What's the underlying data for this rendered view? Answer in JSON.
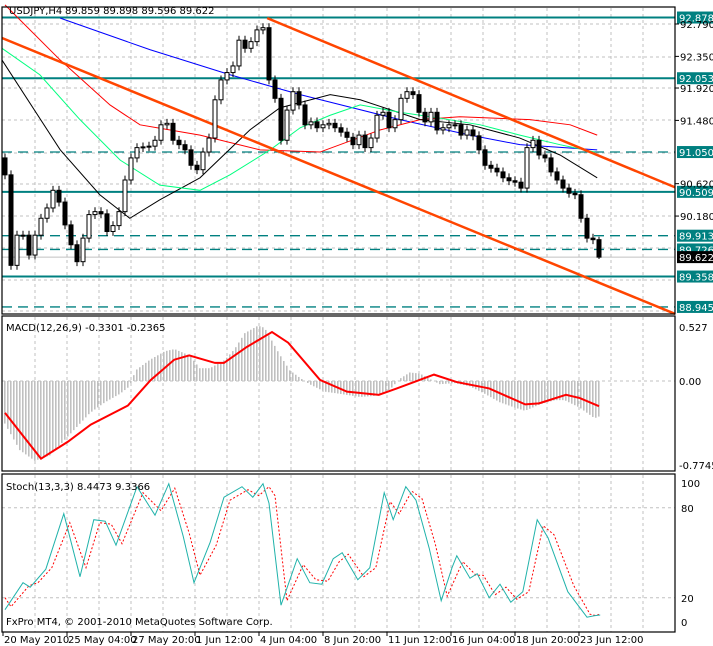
{
  "header": {
    "symbol_label": "USDJPY,H4",
    "ohlc_label": "89.859 89.898 89.596 89.622"
  },
  "macd_panel": {
    "label": "MACD(12,26,9) -0.3301 -0.2365"
  },
  "stoch_panel": {
    "label": "Stoch(13,3,3) 8.4473 9.3366"
  },
  "copyright": "FxPro MT4, © 2001-2010 MetaQuotes Software Corp.",
  "colors": {
    "level_line": "#008080",
    "trend_line": "#ff4500",
    "ma_blue": "#0000ff",
    "ma_red": "#ff0000",
    "ma_black": "#000000",
    "ma_green": "#00ff7f",
    "macd_hist": "#c0c0c0",
    "macd_signal": "#ff0000",
    "stoch_main": "#20b2aa",
    "stoch_signal": "#ff0000",
    "grid": "#c0c0c0"
  },
  "chart_data": [
    {
      "type": "candlestick",
      "title": "USDJPY,H4",
      "x_unit": "bar index (H4 bars)",
      "x_tick_labels": [
        "20 May 2010",
        "25 May 04:00",
        "27 May 20:00",
        "1 Jun 12:00",
        "4 Jun 04:00",
        "8 Jun 20:00",
        "11 Jun 12:00",
        "16 Jun 04:00",
        "18 Jun 20:00",
        "23 Jun 12:00"
      ],
      "ylim": [
        88.86,
        93.05
      ],
      "y_tick_labels": [
        "92.790",
        "92.350",
        "91.920",
        "91.480",
        "90.620",
        "90.180"
      ],
      "last": {
        "open": 89.859,
        "high": 89.898,
        "low": 89.596,
        "close": 89.622
      },
      "closes": [
        90.74,
        89.51,
        89.92,
        89.92,
        89.65,
        89.92,
        90.15,
        90.29,
        90.53,
        90.37,
        90.06,
        89.79,
        89.56,
        89.88,
        90.2,
        90.24,
        90.21,
        89.97,
        90.05,
        90.24,
        90.67,
        90.97,
        91.11,
        91.12,
        91.13,
        91.21,
        91.42,
        91.44,
        91.21,
        91.15,
        91.08,
        90.87,
        90.81,
        91.05,
        91.24,
        91.76,
        92.03,
        92.13,
        92.22,
        92.57,
        92.46,
        92.55,
        92.71,
        92.74,
        92.03,
        91.78,
        91.21,
        91.62,
        91.87,
        91.69,
        91.42,
        91.46,
        91.38,
        91.42,
        91.44,
        91.38,
        91.32,
        91.25,
        91.15,
        91.28,
        91.11,
        91.24,
        91.55,
        91.59,
        91.38,
        91.49,
        91.78,
        91.87,
        91.83,
        91.59,
        91.46,
        91.59,
        91.35,
        91.38,
        91.42,
        91.42,
        91.28,
        91.35,
        91.27,
        91.08,
        90.87,
        90.83,
        90.78,
        90.7,
        90.66,
        90.64,
        90.56,
        91.11,
        91.21,
        91.01,
        90.97,
        90.78,
        90.67,
        90.56,
        90.49,
        90.47,
        90.15,
        89.88,
        89.859,
        89.622
      ],
      "levels": [
        {
          "price": 92.878,
          "label": "92.878",
          "style": "solid"
        },
        {
          "price": 92.053,
          "label": "92.053",
          "style": "solid"
        },
        {
          "price": 91.05,
          "label": "91.050",
          "style": "dashed"
        },
        {
          "price": 90.509,
          "label": "90.509",
          "style": "solid"
        },
        {
          "price": 89.913,
          "label": "89.913",
          "style": "dashed"
        },
        {
          "price": 89.726,
          "label": "89.726",
          "style": "dashed"
        },
        {
          "price": 89.358,
          "label": "89.358",
          "style": "solid"
        },
        {
          "price": 88.945,
          "label": "88.945",
          "style": "dashed"
        }
      ],
      "bid": {
        "price": 89.622,
        "label": "89.622"
      },
      "trend_lines": [
        {
          "name": "upper-channel",
          "from": [
            43.7,
            92.87
          ],
          "to": [
            111.7,
            90.57
          ]
        },
        {
          "name": "lower-channel",
          "from": [
            -0.5,
            92.6
          ],
          "to": [
            111.7,
            88.85
          ]
        }
      ],
      "moving_averages": [
        {
          "name": "blue",
          "points": [
            [
              9.2,
              92.87
            ],
            [
              24.2,
              92.44
            ],
            [
              37.5,
              92.1
            ],
            [
              49.2,
              91.83
            ],
            [
              65.8,
              91.49
            ],
            [
              77.5,
              91.28
            ],
            [
              85.8,
              91.15
            ],
            [
              98.7,
              91.08
            ]
          ]
        },
        {
          "name": "red",
          "points": [
            [
              0,
              93.05
            ],
            [
              9.2,
              92.3
            ],
            [
              17.5,
              91.69
            ],
            [
              22.5,
              91.42
            ],
            [
              32.5,
              91.28
            ],
            [
              42.5,
              91.08
            ],
            [
              52.5,
              91.05
            ],
            [
              62.5,
              91.35
            ],
            [
              69.2,
              91.49
            ],
            [
              75.8,
              91.53
            ],
            [
              87.5,
              91.49
            ],
            [
              94.2,
              91.42
            ],
            [
              98.7,
              91.28
            ]
          ]
        },
        {
          "name": "black",
          "points": [
            [
              -0.5,
              92.3
            ],
            [
              9.2,
              91.08
            ],
            [
              15.8,
              90.47
            ],
            [
              20.8,
              90.15
            ],
            [
              25.8,
              90.4
            ],
            [
              32.5,
              90.7
            ],
            [
              40.8,
              91.35
            ],
            [
              45.8,
              91.65
            ],
            [
              54.2,
              91.83
            ],
            [
              59.2,
              91.76
            ],
            [
              69.2,
              91.49
            ],
            [
              77.5,
              91.42
            ],
            [
              85.8,
              91.24
            ],
            [
              92.5,
              91.01
            ],
            [
              98.7,
              90.7
            ]
          ]
        },
        {
          "name": "green",
          "points": [
            [
              -0.5,
              92.46
            ],
            [
              5.8,
              92.1
            ],
            [
              12.5,
              91.49
            ],
            [
              19.2,
              90.94
            ],
            [
              25.8,
              90.6
            ],
            [
              32.5,
              90.53
            ],
            [
              37.5,
              90.74
            ],
            [
              44.2,
              91.08
            ],
            [
              49.2,
              91.38
            ],
            [
              54.2,
              91.55
            ],
            [
              59.2,
              91.69
            ],
            [
              65.8,
              91.59
            ],
            [
              72.5,
              91.51
            ],
            [
              79.2,
              91.42
            ],
            [
              85.8,
              91.28
            ],
            [
              92.5,
              91.15
            ],
            [
              98.3,
              91.05
            ]
          ]
        }
      ]
    },
    {
      "type": "bar+line",
      "title": "MACD(12,26,9)",
      "ylim": [
        -0.7745,
        0.527
      ],
      "y_tick_labels": [
        "0.527",
        "0.00",
        "-0.7745"
      ],
      "main_value": -0.3301,
      "signal_value": -0.2365,
      "histogram": [
        [
          0,
          -0.4
        ],
        [
          2.5,
          -0.65
        ],
        [
          5,
          -0.75
        ],
        [
          7.5,
          -0.7
        ],
        [
          9.2,
          -0.6
        ],
        [
          11.7,
          -0.45
        ],
        [
          14.2,
          -0.3
        ],
        [
          16.7,
          -0.2
        ],
        [
          19.2,
          -0.12
        ],
        [
          20.8,
          -0.05
        ],
        [
          21.8,
          0.1
        ],
        [
          24.2,
          0.2
        ],
        [
          26.7,
          0.28
        ],
        [
          28.3,
          0.3
        ],
        [
          30.8,
          0.24
        ],
        [
          32.5,
          0.12
        ],
        [
          34.2,
          0.12
        ],
        [
          36.7,
          0.2
        ],
        [
          38.3,
          0.3
        ],
        [
          40,
          0.45
        ],
        [
          42.2,
          0.52
        ],
        [
          43.3,
          0.5
        ],
        [
          44.5,
          0.38
        ],
        [
          45.8,
          0.25
        ],
        [
          47.5,
          0.1
        ],
        [
          49.2,
          0.03
        ],
        [
          50.8,
          -0.03
        ],
        [
          53.3,
          -0.1
        ],
        [
          55.8,
          -0.12
        ],
        [
          59.2,
          -0.15
        ],
        [
          61.7,
          -0.14
        ],
        [
          64.2,
          -0.08
        ],
        [
          65.8,
          0.02
        ],
        [
          67.5,
          0.08
        ],
        [
          69.2,
          0.07
        ],
        [
          70.8,
          0.02
        ],
        [
          72.5,
          -0.03
        ],
        [
          75,
          -0.02
        ],
        [
          77.5,
          -0.05
        ],
        [
          80,
          -0.12
        ],
        [
          82.5,
          -0.2
        ],
        [
          85,
          -0.25
        ],
        [
          86.7,
          -0.28
        ],
        [
          89.2,
          -0.22
        ],
        [
          91.7,
          -0.18
        ],
        [
          93.3,
          -0.18
        ],
        [
          95.8,
          -0.25
        ],
        [
          98.3,
          -0.35
        ],
        [
          99.2,
          -0.33
        ]
      ],
      "signal": [
        [
          0,
          -0.3
        ],
        [
          6,
          -0.73
        ],
        [
          10.5,
          -0.57
        ],
        [
          14.3,
          -0.41
        ],
        [
          20.5,
          -0.23
        ],
        [
          24.3,
          0.01
        ],
        [
          28.2,
          0.2
        ],
        [
          30.7,
          0.24
        ],
        [
          35,
          0.17
        ],
        [
          36.5,
          0.17
        ],
        [
          40.3,
          0.32
        ],
        [
          44.5,
          0.46
        ],
        [
          47.2,
          0.36
        ],
        [
          52.5,
          0.01
        ],
        [
          57,
          -0.1
        ],
        [
          62.3,
          -0.13
        ],
        [
          65.3,
          -0.07
        ],
        [
          71.5,
          0.06
        ],
        [
          75.3,
          -0.01
        ],
        [
          80.7,
          -0.07
        ],
        [
          86.7,
          -0.22
        ],
        [
          89,
          -0.21
        ],
        [
          93.5,
          -0.13
        ],
        [
          95.8,
          -0.16
        ],
        [
          99,
          -0.2365
        ]
      ]
    },
    {
      "type": "line",
      "title": "Stoch(13,3,3)",
      "ylim": [
        0,
        100
      ],
      "y_tick_labels": [
        "100",
        "80",
        "20",
        "0"
      ],
      "levels": [
        80,
        20
      ],
      "main_value": 8.4473,
      "signal_value": 9.3366,
      "main": [
        [
          0,
          12
        ],
        [
          3,
          30
        ],
        [
          4.2,
          27
        ],
        [
          6.8,
          39
        ],
        [
          9.8,
          76
        ],
        [
          12.5,
          34
        ],
        [
          14.8,
          72
        ],
        [
          16.7,
          71
        ],
        [
          18.5,
          55
        ],
        [
          22,
          94
        ],
        [
          25,
          75
        ],
        [
          27.3,
          96
        ],
        [
          29.7,
          61
        ],
        [
          31.5,
          30
        ],
        [
          34.2,
          57
        ],
        [
          36.5,
          87
        ],
        [
          39.5,
          94
        ],
        [
          41.3,
          87
        ],
        [
          43,
          96
        ],
        [
          44,
          83
        ],
        [
          46,
          15
        ],
        [
          48.7,
          46
        ],
        [
          50.8,
          30
        ],
        [
          52.8,
          29
        ],
        [
          54.7,
          46
        ],
        [
          56.2,
          50
        ],
        [
          58.8,
          32
        ],
        [
          60.8,
          40
        ],
        [
          63.2,
          90
        ],
        [
          64.7,
          72
        ],
        [
          66.8,
          94
        ],
        [
          68.5,
          85
        ],
        [
          70.7,
          53
        ],
        [
          72.7,
          18
        ],
        [
          74.5,
          40
        ],
        [
          75.3,
          48
        ],
        [
          77.5,
          33
        ],
        [
          78.7,
          36
        ],
        [
          80.7,
          20
        ],
        [
          82.5,
          29
        ],
        [
          84.3,
          17
        ],
        [
          86.3,
          24
        ],
        [
          88.7,
          72
        ],
        [
          90.5,
          60
        ],
        [
          93.8,
          24
        ],
        [
          97,
          7
        ],
        [
          98.2,
          8
        ],
        [
          99.2,
          8.4473
        ]
      ],
      "signal": [
        [
          0,
          20
        ],
        [
          1,
          14
        ],
        [
          4,
          28
        ],
        [
          5.5,
          30
        ],
        [
          7.8,
          40
        ],
        [
          10.8,
          70
        ],
        [
          13.5,
          40
        ],
        [
          15.8,
          70
        ],
        [
          17.7,
          69
        ],
        [
          19.5,
          56
        ],
        [
          23,
          90
        ],
        [
          26,
          78
        ],
        [
          28.3,
          93
        ],
        [
          30.7,
          63
        ],
        [
          32.5,
          35
        ],
        [
          35.2,
          55
        ],
        [
          37.5,
          85
        ],
        [
          40.5,
          92
        ],
        [
          42.3,
          88
        ],
        [
          44,
          94
        ],
        [
          45,
          88
        ],
        [
          47,
          18
        ],
        [
          49.7,
          42
        ],
        [
          51.8,
          32
        ],
        [
          53.8,
          31
        ],
        [
          55.7,
          44
        ],
        [
          57.2,
          49
        ],
        [
          59.8,
          34
        ],
        [
          61.8,
          40
        ],
        [
          64.2,
          84
        ],
        [
          65.7,
          76
        ],
        [
          67.8,
          91
        ],
        [
          69.5,
          86
        ],
        [
          71.7,
          56
        ],
        [
          73.7,
          21
        ],
        [
          75.5,
          37
        ],
        [
          76.3,
          44
        ],
        [
          78.5,
          35
        ],
        [
          79.7,
          35
        ],
        [
          81.7,
          22
        ],
        [
          83.5,
          27
        ],
        [
          85.3,
          19
        ],
        [
          87.3,
          24
        ],
        [
          89.7,
          68
        ],
        [
          91.5,
          62
        ],
        [
          94.8,
          28
        ],
        [
          97.5,
          9
        ],
        [
          98.5,
          8
        ],
        [
          99.2,
          9.3366
        ]
      ]
    }
  ]
}
